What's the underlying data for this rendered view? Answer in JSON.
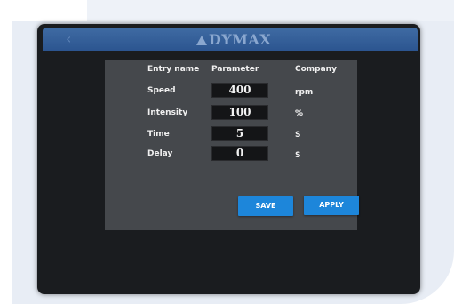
{
  "brand": {
    "logo_text": "DYMAX"
  },
  "header": {
    "back_icon": "chevron-left-icon"
  },
  "table": {
    "columns": [
      "Entry name",
      "Parameter",
      "Company"
    ],
    "rows": [
      {
        "label": "Speed",
        "value": "400",
        "unit": "rpm"
      },
      {
        "label": "Intensity",
        "value": "100",
        "unit": "%"
      },
      {
        "label": "Time",
        "value": "5",
        "unit": "S"
      },
      {
        "label": "Delay",
        "value": "0",
        "unit": "S"
      }
    ]
  },
  "buttons": {
    "save": "SAVE",
    "apply": "APPLY"
  },
  "colors": {
    "header": "#2c5590",
    "screen": "#45484c",
    "button": "#1d86da"
  }
}
